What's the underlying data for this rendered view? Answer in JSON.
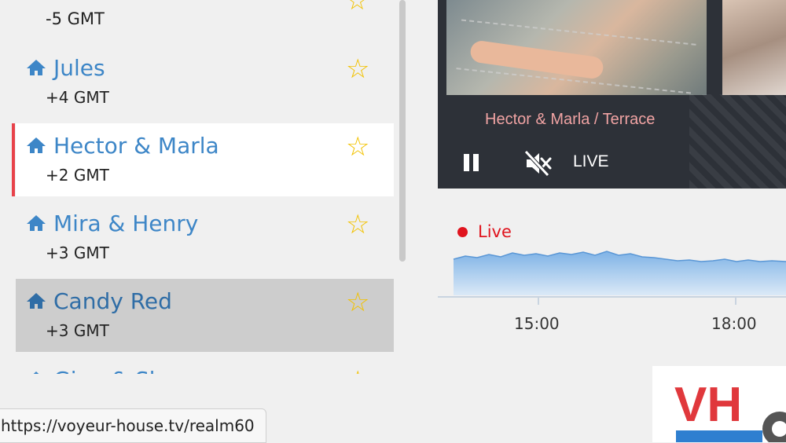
{
  "sidebar": {
    "partial_top_tz": "-5 GMT",
    "rooms": [
      {
        "name": "Jules",
        "tz": "+4 GMT",
        "state": "normal"
      },
      {
        "name": "Hector & Marla",
        "tz": "+2 GMT",
        "state": "active"
      },
      {
        "name": "Mira & Henry",
        "tz": "+3 GMT",
        "state": "normal"
      },
      {
        "name": "Candy Red",
        "tz": "+3 GMT",
        "state": "hover"
      },
      {
        "name": "Gina & Sky",
        "tz": "",
        "state": "partial"
      }
    ]
  },
  "player": {
    "caption": "Hector & Marla / Terrace",
    "live_label": "LIVE"
  },
  "activity": {
    "live_label": "Live",
    "ticks": [
      "15:00",
      "18:00"
    ]
  },
  "logo": {
    "text": "VH TV"
  },
  "statusbar": {
    "url": "https://voyeur-house.tv/realm60"
  },
  "colors": {
    "accent": "#3d86c7",
    "active_marker": "#e8424a",
    "star": "#f2c200",
    "live": "#e0141e"
  }
}
